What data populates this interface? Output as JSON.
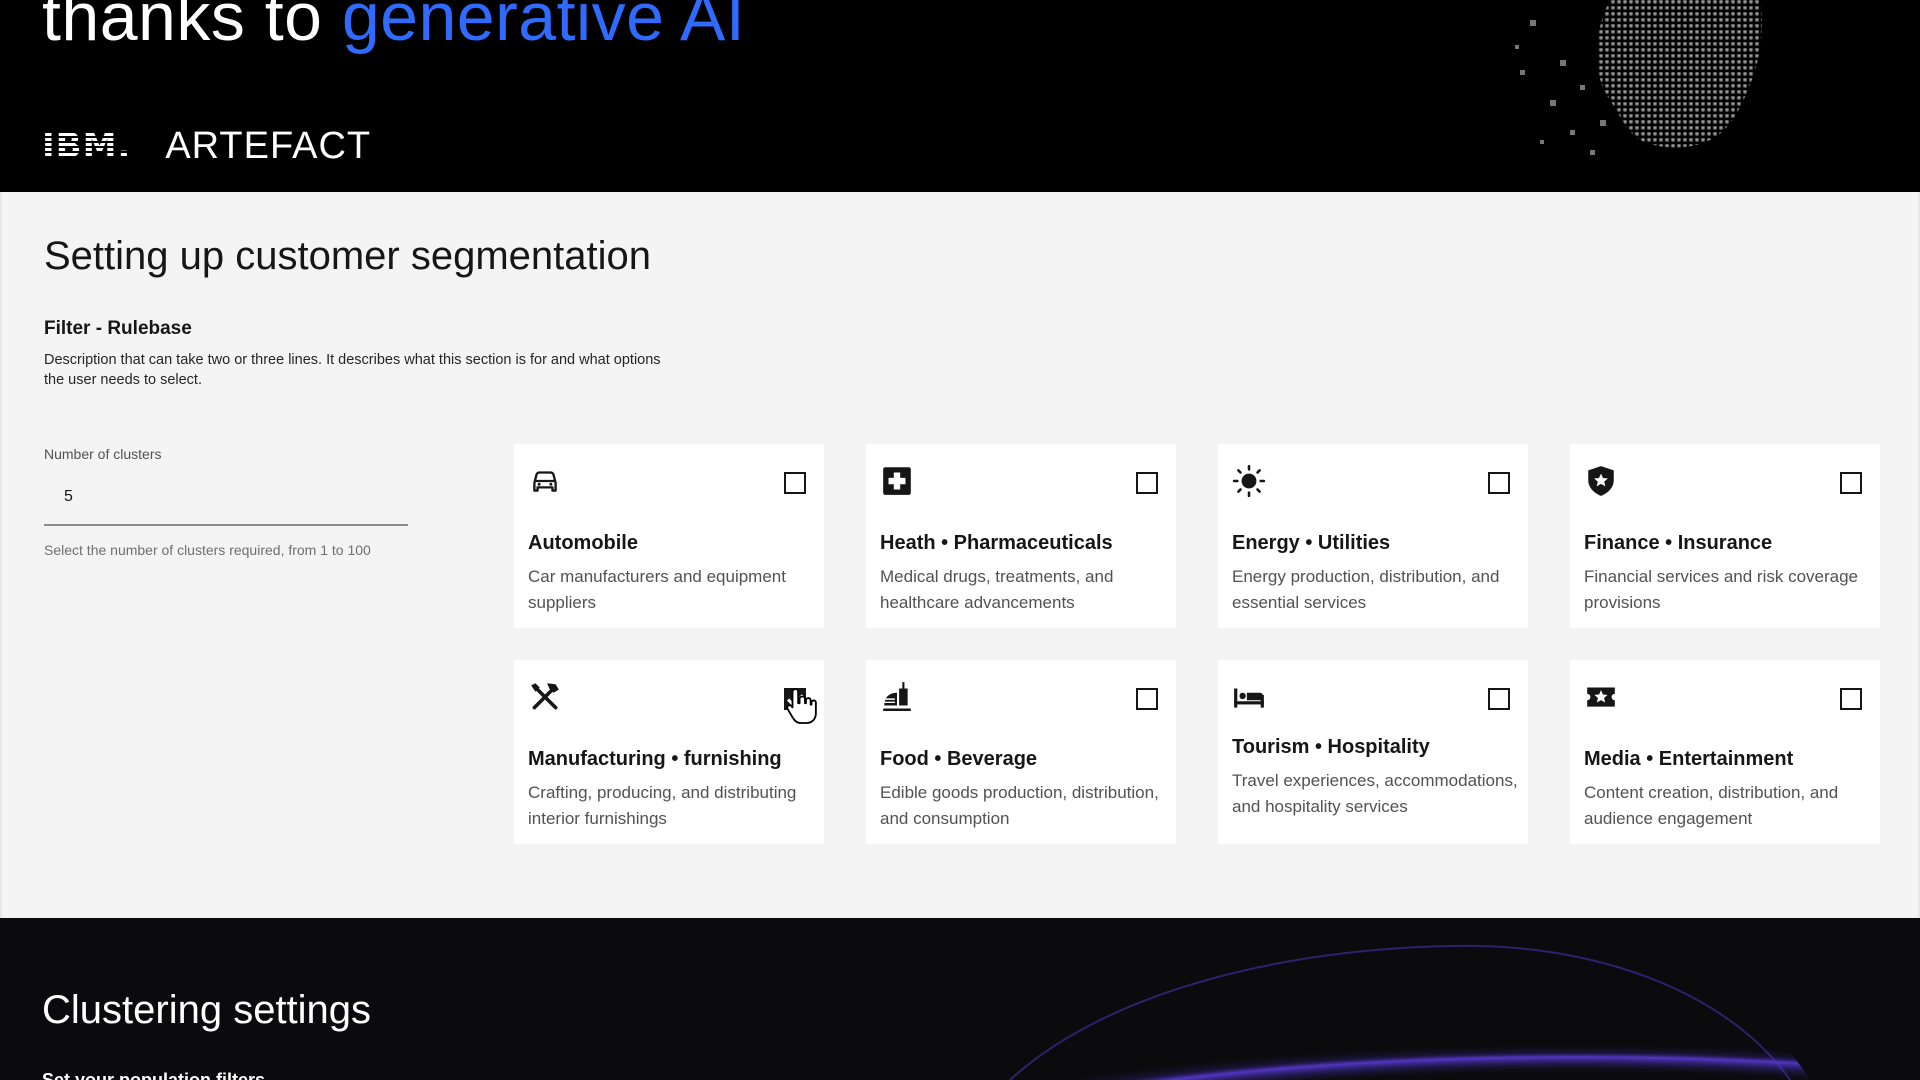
{
  "hero": {
    "headline_prefix": "thanks to ",
    "headline_accent": "generative AI",
    "logo_ibm": "IBM.",
    "logo_artefact": "ARTEFACT"
  },
  "main": {
    "title": "Setting up customer segmentation",
    "section_title": "Filter - Rulebase",
    "section_desc": "Description that can take two or three lines. It describes what this section is for and what options the user needs to select.",
    "clusters": {
      "label": "Number of clusters",
      "value": "5",
      "help": "Select the number of clusters required, from 1 to 100"
    },
    "cards": [
      {
        "icon": "car-icon",
        "title": "Automobile",
        "desc": "Car manufacturers and equipment suppliers",
        "checked": false
      },
      {
        "icon": "medical-cross-icon",
        "title": "Heath • Pharmaceuticals",
        "desc": "Medical drugs, treatments, and healthcare advancements",
        "checked": false
      },
      {
        "icon": "sun-icon",
        "title": "Energy • Utilities",
        "desc": "Energy production, distribution, and essential services",
        "checked": false
      },
      {
        "icon": "shield-star-icon",
        "title": "Finance • Insurance",
        "desc": "Financial services and risk coverage provisions",
        "checked": false
      },
      {
        "icon": "tools-icon",
        "title": "Manufacturing • furnishing",
        "desc": "Crafting, producing, and distributing interior furnishings",
        "checked": true
      },
      {
        "icon": "food-serving-icon",
        "title": "Food • Beverage",
        "desc": "Edible goods production, distribution, and consumption",
        "checked": false
      },
      {
        "icon": "bed-icon",
        "title": "Tourism • Hospitality",
        "desc": "Travel experiences, accommodations, and hospitality services",
        "checked": false
      },
      {
        "icon": "star-ticket-icon",
        "title": "Media • Entertainment",
        "desc": "Content creation, distribution, and audience engagement",
        "checked": false
      }
    ]
  },
  "bottom": {
    "title": "Clustering settings",
    "subtitle": "Set your population filters"
  },
  "colors": {
    "accent_blue": "#2f6bff",
    "panel_bg": "#f4f4f4",
    "card_bg": "#ffffff",
    "dark_bg": "#0b0b0d",
    "arc_purple": "#5a3bd6"
  }
}
